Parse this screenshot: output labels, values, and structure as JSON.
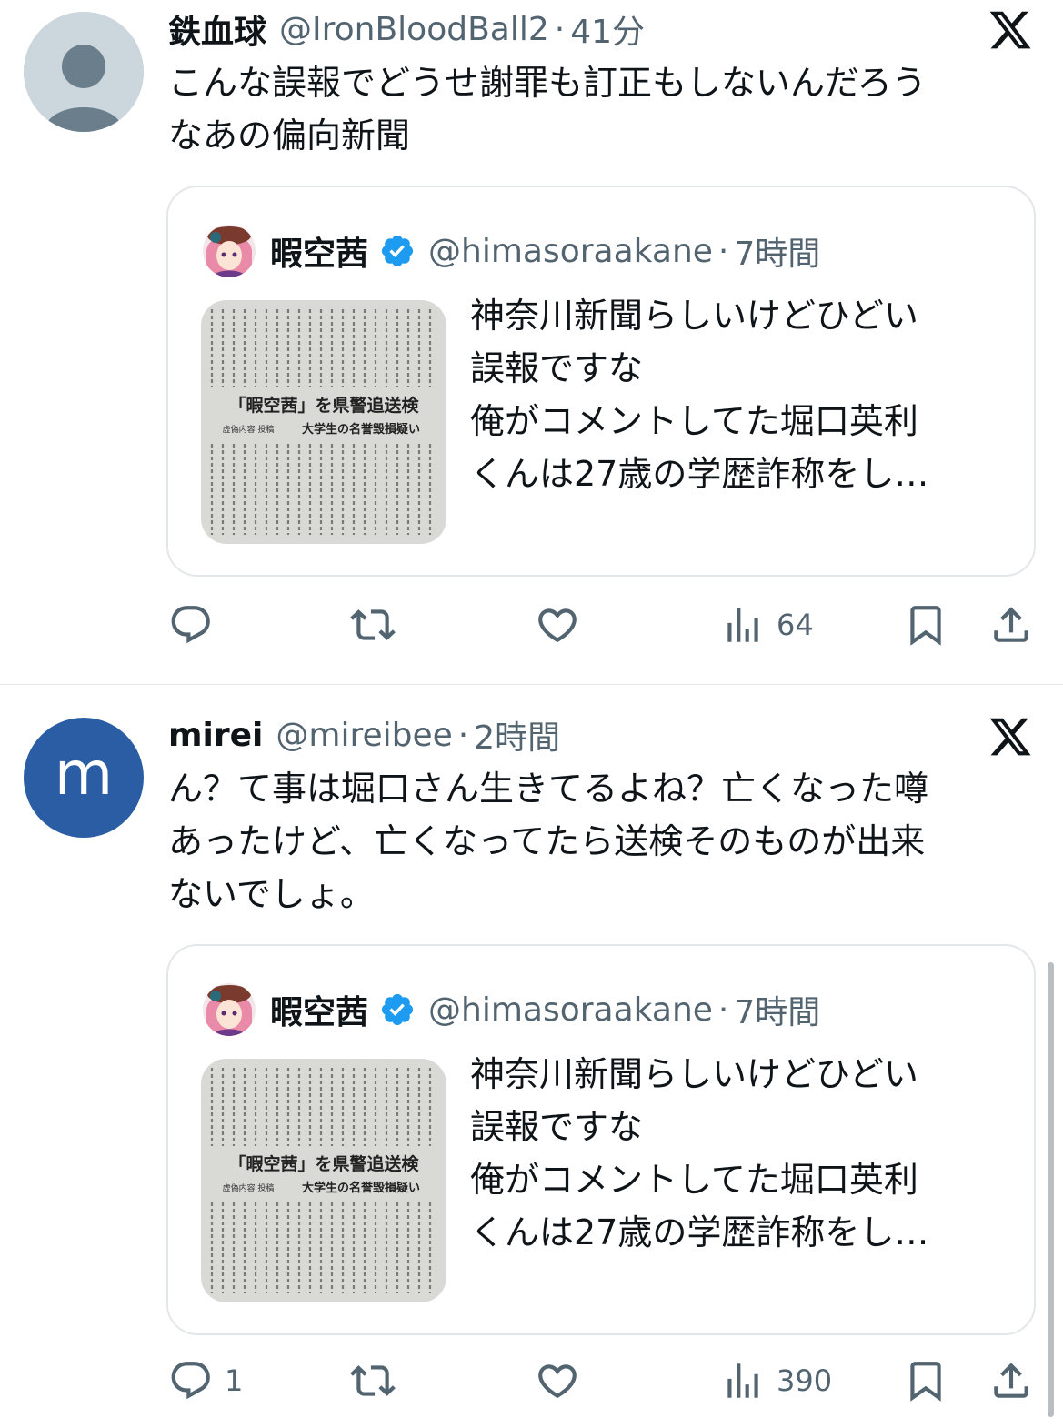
{
  "tweets": [
    {
      "display_name": "鉄血球",
      "handle": "@IronBloodBall2",
      "separator": "·",
      "time": "41分",
      "avatar": "default-person-icon",
      "text_lines": [
        "こんな誤報でどうせ謝罪も訂正もしないんだろう",
        "なあの偏向新聞"
      ],
      "quote": {
        "display_name": "暇空茜",
        "handle": "@himasoraakane",
        "separator": "·",
        "time": "7時間",
        "verified": true,
        "text_lines": [
          "神奈川新聞らしいけどひどい",
          "誤報ですな",
          "俺がコメントしてた堀口英利",
          "くんは27歳の学歴詐称をし…"
        ],
        "image": {
          "headline": "「暇空茜」を県警追送検",
          "subhead": "大学生の名誉毀損疑い",
          "kicker": "虚偽内容 投稿"
        }
      },
      "actions": {
        "reply_count": "",
        "views_count": "64"
      }
    },
    {
      "display_name": "mirei",
      "handle": "@mireibee",
      "separator": "·",
      "time": "2時間",
      "avatar_letter": "m",
      "text_lines": [
        "ん？て事は堀口さん生きてるよね？亡くなった噂",
        "あったけど、亡くなってたら送検そのものが出来",
        "ないでしょ。"
      ],
      "quote": {
        "display_name": "暇空茜",
        "handle": "@himasoraakane",
        "separator": "·",
        "time": "7時間",
        "verified": true,
        "text_lines": [
          "神奈川新聞らしいけどひどい",
          "誤報ですな",
          "俺がコメントしてた堀口英利",
          "くんは27歳の学歴詐称をし…"
        ],
        "image": {
          "headline": "「暇空茜」を県警追送検",
          "subhead": "大学生の名誉毀損疑い",
          "kicker": "虚偽内容 投稿"
        }
      },
      "actions": {
        "reply_count": "1",
        "views_count": "390"
      }
    }
  ],
  "icons": [
    "x-logo-icon",
    "reply-icon",
    "retweet-icon",
    "like-icon",
    "views-icon",
    "bookmark-icon",
    "share-icon",
    "verified-badge-icon"
  ],
  "colors": {
    "text": "#0f1419",
    "secondary": "#536471",
    "verified": "#1d9bf0",
    "avatar_blue": "#2a5da3",
    "border": "#e3e7ea"
  }
}
